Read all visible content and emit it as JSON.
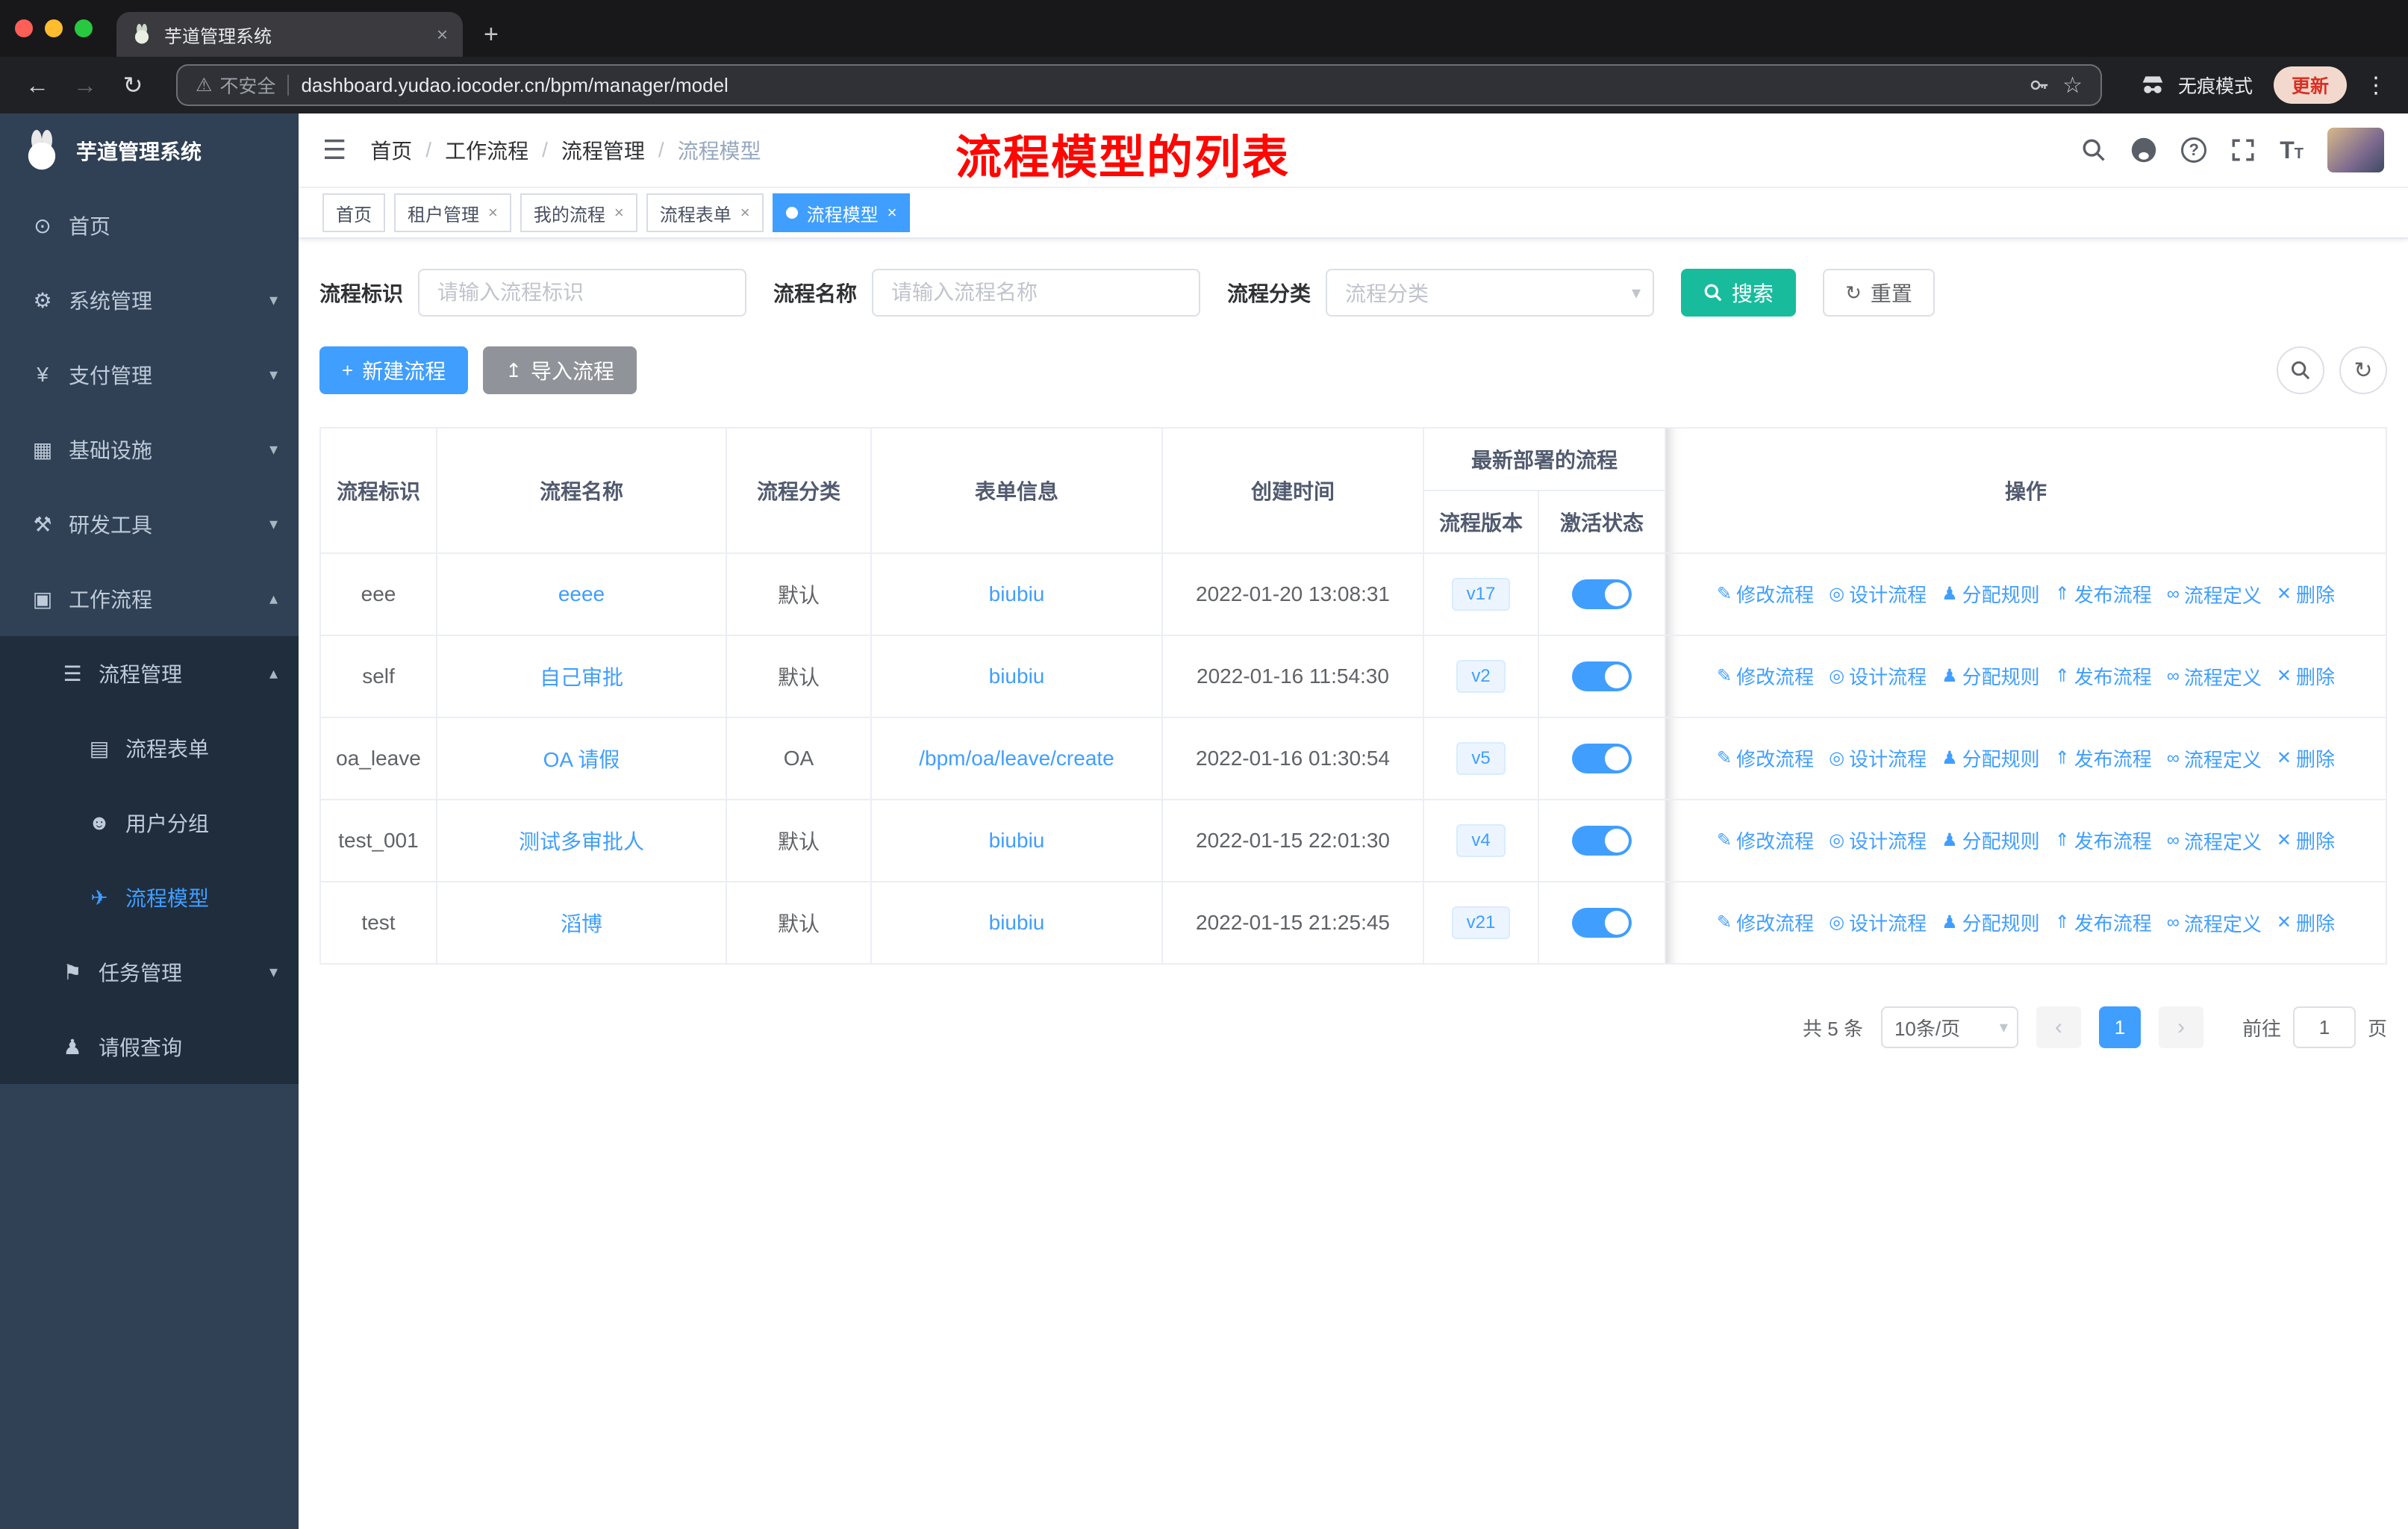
{
  "browser": {
    "tab_title": "芋道管理系统",
    "security_label": "不安全",
    "url": "dashboard.yudao.iocoder.cn/bpm/manager/model",
    "incognito_label": "无痕模式",
    "update_label": "更新"
  },
  "icons": {
    "dashboard": "⊙",
    "gear": "⚙",
    "yen": "¥",
    "monitor": "▦",
    "tools": "⚒",
    "briefcase": "▣",
    "list": "☰",
    "document": "▤",
    "users": "☻",
    "send": "✈",
    "flag": "⚑",
    "person": "♟",
    "edit": "✎",
    "design": "◎",
    "publish": "⇑",
    "clip": "∞",
    "trash": "✕",
    "plus": "+",
    "upload": "↥",
    "refresh": "↻",
    "close": "×",
    "caret_down": "▾",
    "caret_up": "▴",
    "hamburger": "☰",
    "back": "←",
    "forward": "→",
    "reload": "↻",
    "warning": "⚠",
    "star": "☆",
    "dots": "⋮",
    "prev": "‹",
    "next": "›"
  },
  "sidebar": {
    "logo_title": "芋道管理系统",
    "items": [
      {
        "label": "首页"
      },
      {
        "label": "系统管理"
      },
      {
        "label": "支付管理"
      },
      {
        "label": "基础设施"
      },
      {
        "label": "研发工具"
      },
      {
        "label": "工作流程"
      },
      {
        "label": "流程管理"
      },
      {
        "label": "流程表单"
      },
      {
        "label": "用户分组"
      },
      {
        "label": "流程模型"
      },
      {
        "label": "任务管理"
      },
      {
        "label": "请假查询"
      }
    ]
  },
  "header": {
    "breadcrumb": [
      "首页",
      "工作流程",
      "流程管理",
      "流程模型"
    ],
    "annotation": "流程模型的列表"
  },
  "tags": [
    {
      "label": "首页"
    },
    {
      "label": "租户管理"
    },
    {
      "label": "我的流程"
    },
    {
      "label": "流程表单"
    },
    {
      "label": "流程模型"
    }
  ],
  "filters": {
    "key_label": "流程标识",
    "key_placeholder": "请输入流程标识",
    "name_label": "流程名称",
    "name_placeholder": "请输入流程名称",
    "category_label": "流程分类",
    "category_placeholder": "流程分类",
    "search_button": "搜索",
    "reset_button": "重置"
  },
  "toolbar": {
    "create_button": "新建流程",
    "import_button": "导入流程"
  },
  "table": {
    "headers": {
      "key": "流程标识",
      "name": "流程名称",
      "category": "流程分类",
      "form": "表单信息",
      "created": "创建时间",
      "deploy_group": "最新部署的流程",
      "version": "流程版本",
      "active": "激活状态",
      "actions": "操作"
    },
    "action_labels": [
      "修改流程",
      "设计流程",
      "分配规则",
      "发布流程",
      "流程定义",
      "删除"
    ],
    "rows": [
      {
        "key": "eee",
        "name": "eeee",
        "category": "默认",
        "form": "biubiu",
        "created": "2022-01-20 13:08:31",
        "version": "v17",
        "active": true
      },
      {
        "key": "self",
        "name": "自己审批",
        "category": "默认",
        "form": "biubiu",
        "created": "2022-01-16 11:54:30",
        "version": "v2",
        "active": true
      },
      {
        "key": "oa_leave",
        "name": "OA 请假",
        "category": "OA",
        "form": "/bpm/oa/leave/create",
        "created": "2022-01-16 01:30:54",
        "version": "v5",
        "active": true
      },
      {
        "key": "test_001",
        "name": "测试多审批人",
        "category": "默认",
        "form": "biubiu",
        "created": "2022-01-15 22:01:30",
        "version": "v4",
        "active": true
      },
      {
        "key": "test",
        "name": "滔博",
        "category": "默认",
        "form": "biubiu",
        "created": "2022-01-15 21:25:45",
        "version": "v21",
        "active": true
      }
    ]
  },
  "pagination": {
    "total": "共 5 条",
    "page_size": "10条/页",
    "current": "1",
    "goto_label": "前往",
    "goto_value": "1",
    "page_unit": "页"
  }
}
